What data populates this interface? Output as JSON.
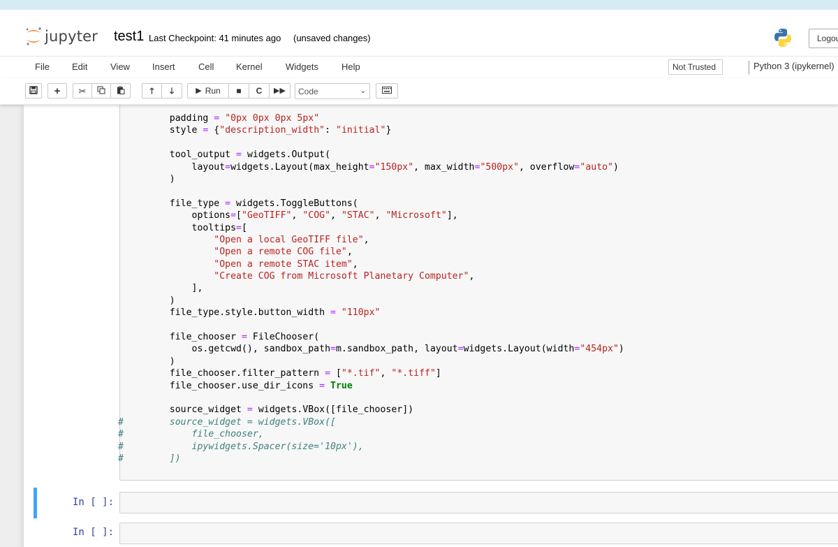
{
  "header": {
    "logo_text": "jupyter",
    "notebook_name": "test1",
    "checkpoint": "Last Checkpoint: 41 minutes ago",
    "autosave_status": "(unsaved changes)",
    "logout_label": "Logout"
  },
  "menubar": {
    "items": [
      "File",
      "Edit",
      "View",
      "Insert",
      "Cell",
      "Kernel",
      "Widgets",
      "Help"
    ],
    "trusted": "Not Trusted",
    "kernel": "Python 3 (ipykernel)"
  },
  "toolbar": {
    "run_label": "Run",
    "cell_type": "Code",
    "icons": [
      "save-icon",
      "plus-icon",
      "scissors-icon",
      "copy-icon",
      "paste-icon",
      "arrow-up-icon",
      "arrow-down-icon",
      "run-icon",
      "stop-icon",
      "restart-icon",
      "fast-forward-icon",
      "keyboard-icon"
    ]
  },
  "cells": [
    {
      "prompt": "",
      "lines": [
        [
          {
            "t": "    padding "
          },
          {
            "c": "o",
            "t": "="
          },
          {
            "t": " "
          },
          {
            "c": "s",
            "t": "\"0px 0px 0px 5px\""
          }
        ],
        [
          {
            "t": "    style "
          },
          {
            "c": "o",
            "t": "="
          },
          {
            "t": " {"
          },
          {
            "c": "s",
            "t": "\"description_width\""
          },
          {
            "t": ": "
          },
          {
            "c": "s",
            "t": "\"initial\""
          },
          {
            "t": "}"
          }
        ],
        [
          {
            "t": ""
          }
        ],
        [
          {
            "t": "    tool_output "
          },
          {
            "c": "o",
            "t": "="
          },
          {
            "t": " widgets.Output("
          }
        ],
        [
          {
            "t": "        layout"
          },
          {
            "c": "o",
            "t": "="
          },
          {
            "t": "widgets.Layout(max_height"
          },
          {
            "c": "o",
            "t": "="
          },
          {
            "c": "s",
            "t": "\"150px\""
          },
          {
            "t": ", max_width"
          },
          {
            "c": "o",
            "t": "="
          },
          {
            "c": "s",
            "t": "\"500px\""
          },
          {
            "t": ", overflow"
          },
          {
            "c": "o",
            "t": "="
          },
          {
            "c": "s",
            "t": "\"auto\""
          },
          {
            "t": ")"
          }
        ],
        [
          {
            "t": "    )"
          }
        ],
        [
          {
            "t": ""
          }
        ],
        [
          {
            "t": "    file_type "
          },
          {
            "c": "o",
            "t": "="
          },
          {
            "t": " widgets.ToggleButtons("
          }
        ],
        [
          {
            "t": "        options"
          },
          {
            "c": "o",
            "t": "="
          },
          {
            "t": "["
          },
          {
            "c": "s",
            "t": "\"GeoTIFF\""
          },
          {
            "t": ", "
          },
          {
            "c": "s",
            "t": "\"COG\""
          },
          {
            "t": ", "
          },
          {
            "c": "s",
            "t": "\"STAC\""
          },
          {
            "t": ", "
          },
          {
            "c": "s",
            "t": "\"Microsoft\""
          },
          {
            "t": "],"
          }
        ],
        [
          {
            "t": "        tooltips"
          },
          {
            "c": "o",
            "t": "="
          },
          {
            "t": "["
          }
        ],
        [
          {
            "t": "            "
          },
          {
            "c": "s",
            "t": "\"Open a local GeoTIFF file\""
          },
          {
            "t": ","
          }
        ],
        [
          {
            "t": "            "
          },
          {
            "c": "s",
            "t": "\"Open a remote COG file\""
          },
          {
            "t": ","
          }
        ],
        [
          {
            "t": "            "
          },
          {
            "c": "s",
            "t": "\"Open a remote STAC item\""
          },
          {
            "t": ","
          }
        ],
        [
          {
            "t": "            "
          },
          {
            "c": "s",
            "t": "\"Create COG from Microsoft Planetary Computer\""
          },
          {
            "t": ","
          }
        ],
        [
          {
            "t": "        ],"
          }
        ],
        [
          {
            "t": "    )"
          }
        ],
        [
          {
            "t": "    file_type.style.button_width "
          },
          {
            "c": "o",
            "t": "="
          },
          {
            "t": " "
          },
          {
            "c": "s",
            "t": "\"110px\""
          }
        ],
        [
          {
            "t": ""
          }
        ],
        [
          {
            "t": "    file_chooser "
          },
          {
            "c": "o",
            "t": "="
          },
          {
            "t": " FileChooser("
          }
        ],
        [
          {
            "t": "        os.getcwd(), sandbox_path"
          },
          {
            "c": "o",
            "t": "="
          },
          {
            "t": "m.sandbox_path, layout"
          },
          {
            "c": "o",
            "t": "="
          },
          {
            "t": "widgets.Layout(width"
          },
          {
            "c": "o",
            "t": "="
          },
          {
            "c": "s",
            "t": "\"454px\""
          },
          {
            "t": ")"
          }
        ],
        [
          {
            "t": "    )"
          }
        ],
        [
          {
            "t": "    file_chooser.filter_pattern "
          },
          {
            "c": "o",
            "t": "="
          },
          {
            "t": " ["
          },
          {
            "c": "s",
            "t": "\"*.tif\""
          },
          {
            "t": ", "
          },
          {
            "c": "s",
            "t": "\"*.tiff\""
          },
          {
            "t": "]"
          }
        ],
        [
          {
            "t": "    file_chooser.use_dir_icons "
          },
          {
            "c": "o",
            "t": "="
          },
          {
            "t": " "
          },
          {
            "c": "k",
            "t": "True"
          }
        ],
        [
          {
            "t": ""
          }
        ],
        [
          {
            "t": "    source_widget "
          },
          {
            "c": "o",
            "t": "="
          },
          {
            "t": " widgets.VBox([file_chooser])"
          }
        ],
        [
          {
            "g": "#"
          },
          {
            "c": "c",
            "t": "    source_widget = widgets.VBox(["
          }
        ],
        [
          {
            "g": "#"
          },
          {
            "c": "c",
            "t": "        file_chooser,"
          }
        ],
        [
          {
            "g": "#"
          },
          {
            "c": "c",
            "t": "        ipywidgets.Spacer(size='10px'),"
          }
        ],
        [
          {
            "g": "#"
          },
          {
            "c": "c",
            "t": "    ])"
          }
        ]
      ]
    },
    {
      "prompt": "In [ ]:",
      "lines": []
    },
    {
      "prompt": "In [ ]:",
      "lines": []
    }
  ]
}
